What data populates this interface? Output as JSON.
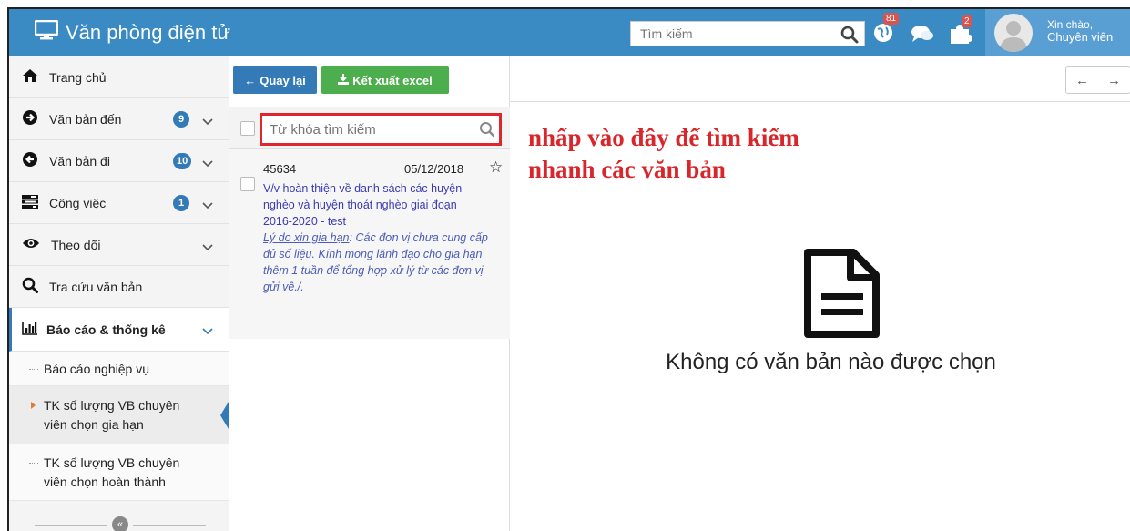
{
  "header": {
    "app_title": "Văn phòng điện tử",
    "search_placeholder": "Tìm kiếm",
    "notif_count_1": "81",
    "notif_count_2": "2",
    "greeting": "Xin chào,",
    "role": "Chuyên viên",
    "accent": "#3a8ac4"
  },
  "sidebar": {
    "items": [
      {
        "label": "Trang chủ",
        "icon": "home-icon"
      },
      {
        "label": "Văn bản đến",
        "count": "9",
        "icon": "arrow-right-circle-icon"
      },
      {
        "label": "Văn bản đi",
        "count": "10",
        "icon": "arrow-left-circle-icon"
      },
      {
        "label": "Công việc",
        "count": "1",
        "icon": "tasks-icon"
      },
      {
        "label": "Theo dõi",
        "icon": "eye-icon"
      },
      {
        "label": "Tra cứu văn bản",
        "icon": "search-icon"
      },
      {
        "label": "Báo cáo & thống kê",
        "icon": "bar-chart-icon"
      }
    ],
    "sub_items": [
      {
        "label": "Báo cáo nghiệp vụ"
      },
      {
        "label": "TK số lượng VB chuyên viên chọn gia hạn"
      },
      {
        "label": "TK số lượng VB chuyên viên chọn hoàn thành"
      }
    ]
  },
  "toolbar": {
    "back_label": "Quay lại",
    "excel_label": "Kết xuất excel"
  },
  "list": {
    "search_placeholder": "Từ khóa tìm kiếm",
    "doc": {
      "number": "45634",
      "date": "05/12/2018",
      "title": "V/v hoàn thiện về danh sách các huyện nghèo và huyện thoát nghèo giai đoạn 2016-2020 - test",
      "reason_label": "Lý do xin gia hạn",
      "reason_text": ": Các đơn vị chưa cung cấp đủ số liệu. Kính mong lãnh đạo cho gia hạn thêm 1 tuần để tổng hợp xử lý từ các đơn vị gửi về./."
    }
  },
  "main": {
    "annotation_line1": "nhấp vào đây để tìm kiếm",
    "annotation_line2": "nhanh các văn bản",
    "empty_message": "Không có văn bản nào được chọn"
  }
}
